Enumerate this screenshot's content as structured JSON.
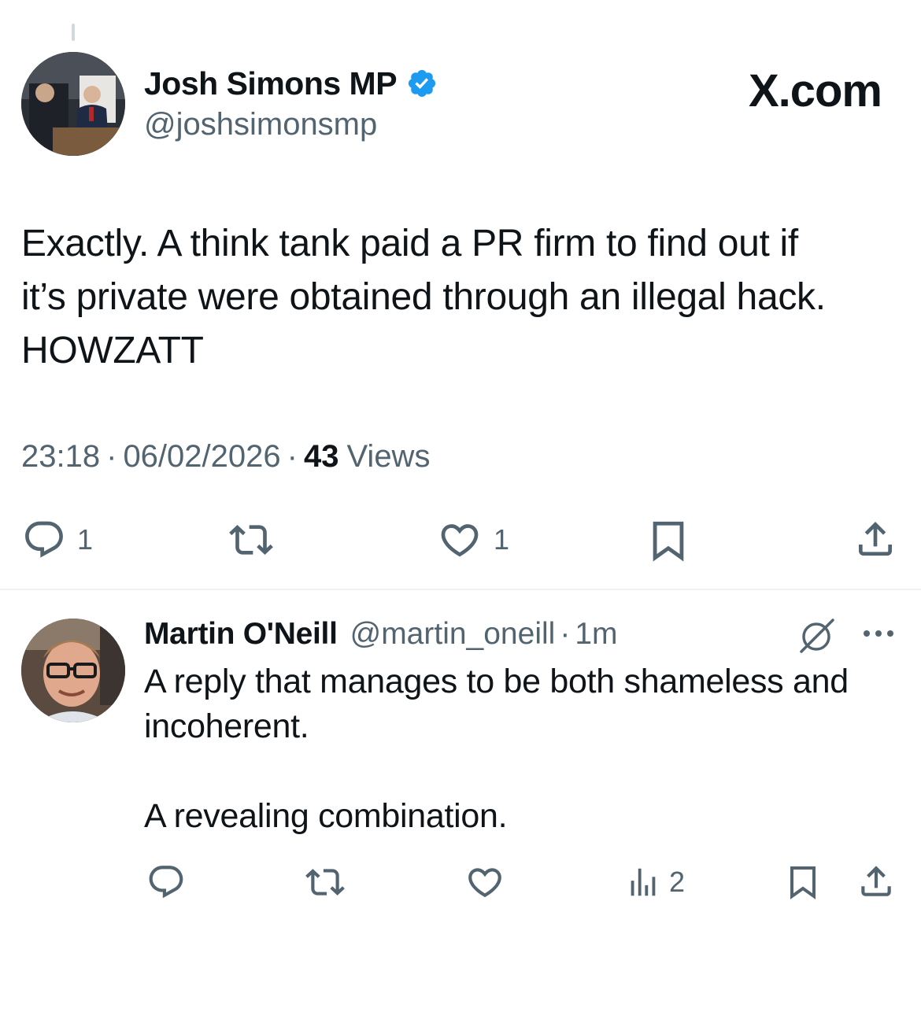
{
  "main_post": {
    "author_name": "Josh Simons MP",
    "author_handle": "@joshsimonsmp",
    "verified": true,
    "watermark": "X.com",
    "text_lines": [
      "Exactly. A think tank paid a PR firm to find out if",
      "it’s private were obtained through an illegal hack.",
      "HOWZATT"
    ],
    "time": "23:18",
    "date": "06/02/2026",
    "views_count": "43",
    "views_label": "Views",
    "separator": "·",
    "actions": {
      "reply_count": "1",
      "like_count": "1"
    }
  },
  "reply_post": {
    "author_name": "Martin O'Neill",
    "author_handle": "@martin_oneill",
    "separator": "·",
    "time": "1m",
    "text_lines": [
      "A reply that manages to be both shameless and",
      "incoherent.",
      "",
      "A revealing combination."
    ],
    "actions": {
      "views_count": "2"
    }
  },
  "colors": {
    "text_primary": "#0f1419",
    "text_secondary": "#536471",
    "verified_blue": "#1d9bf0",
    "divider": "#eff3f4"
  },
  "icons": [
    "reply-icon",
    "retweet-icon",
    "like-icon",
    "bookmark-icon",
    "share-icon",
    "views-icon",
    "grok-icon",
    "more-icon",
    "verified-badge-icon"
  ]
}
